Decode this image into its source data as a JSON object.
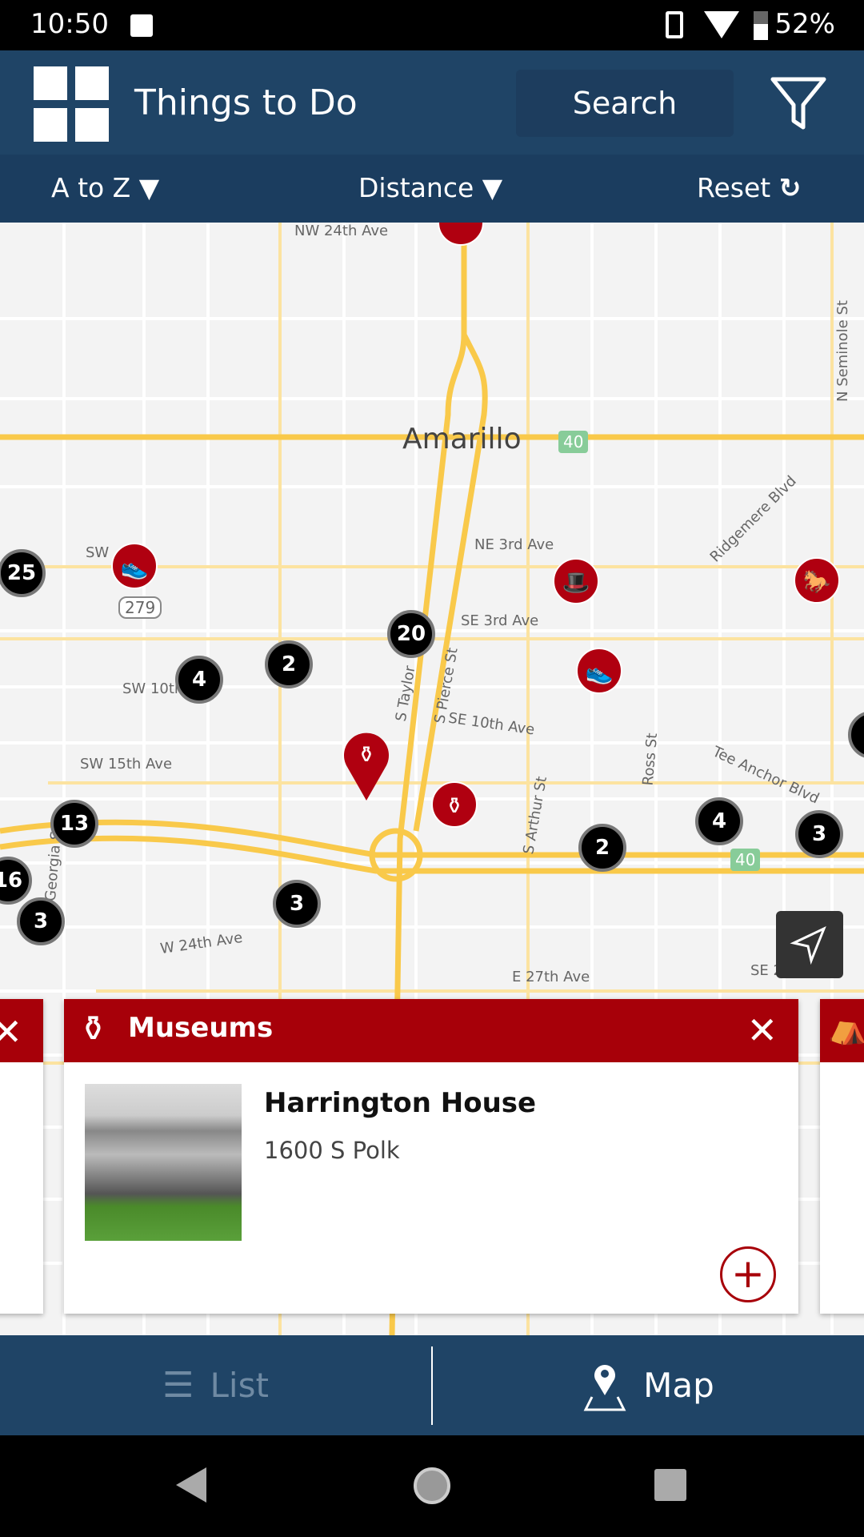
{
  "status": {
    "time": "10:50",
    "battery": "52%",
    "icons": [
      "image-icon",
      "vibrate-icon",
      "wifi-icon",
      "battery-icon"
    ]
  },
  "header": {
    "title": "Things to Do",
    "search_label": "Search",
    "filter_icon": "filter-icon"
  },
  "sortbar": {
    "sort_label": "A to Z",
    "distance_label": "Distance",
    "reset_label": "Reset"
  },
  "map": {
    "city": "Amarillo",
    "shields": [
      "40",
      "279",
      "40"
    ],
    "streets": [
      "NW 24th Ave",
      "N Seminole St",
      "Ridgemere Blvd",
      "NE 3rd Ave",
      "SW",
      "SE 3rd Ave",
      "SW 10th",
      "S Taylor",
      "S Pierce St",
      "SE 10th Ave",
      "SW 15th Ave",
      "S Arthur St",
      "Ross St",
      "Tee Anchor Blvd",
      "Georgia St",
      "W 24th Ave",
      "E 27th Ave",
      "SE 27th Ave"
    ],
    "clusters": [
      "25",
      "4",
      "2",
      "20",
      "13",
      "16",
      "3",
      "3",
      "2",
      "4",
      "3"
    ]
  },
  "card": {
    "category": "Museums",
    "name": "Harrington House",
    "address": "1600 S Polk",
    "accent": "#a70009"
  },
  "tabs": {
    "list_label": "List",
    "map_label": "Map",
    "active": "Map"
  },
  "colors": {
    "header": "#1f4466",
    "poi": "#b00010",
    "road": "#f9c94a"
  }
}
